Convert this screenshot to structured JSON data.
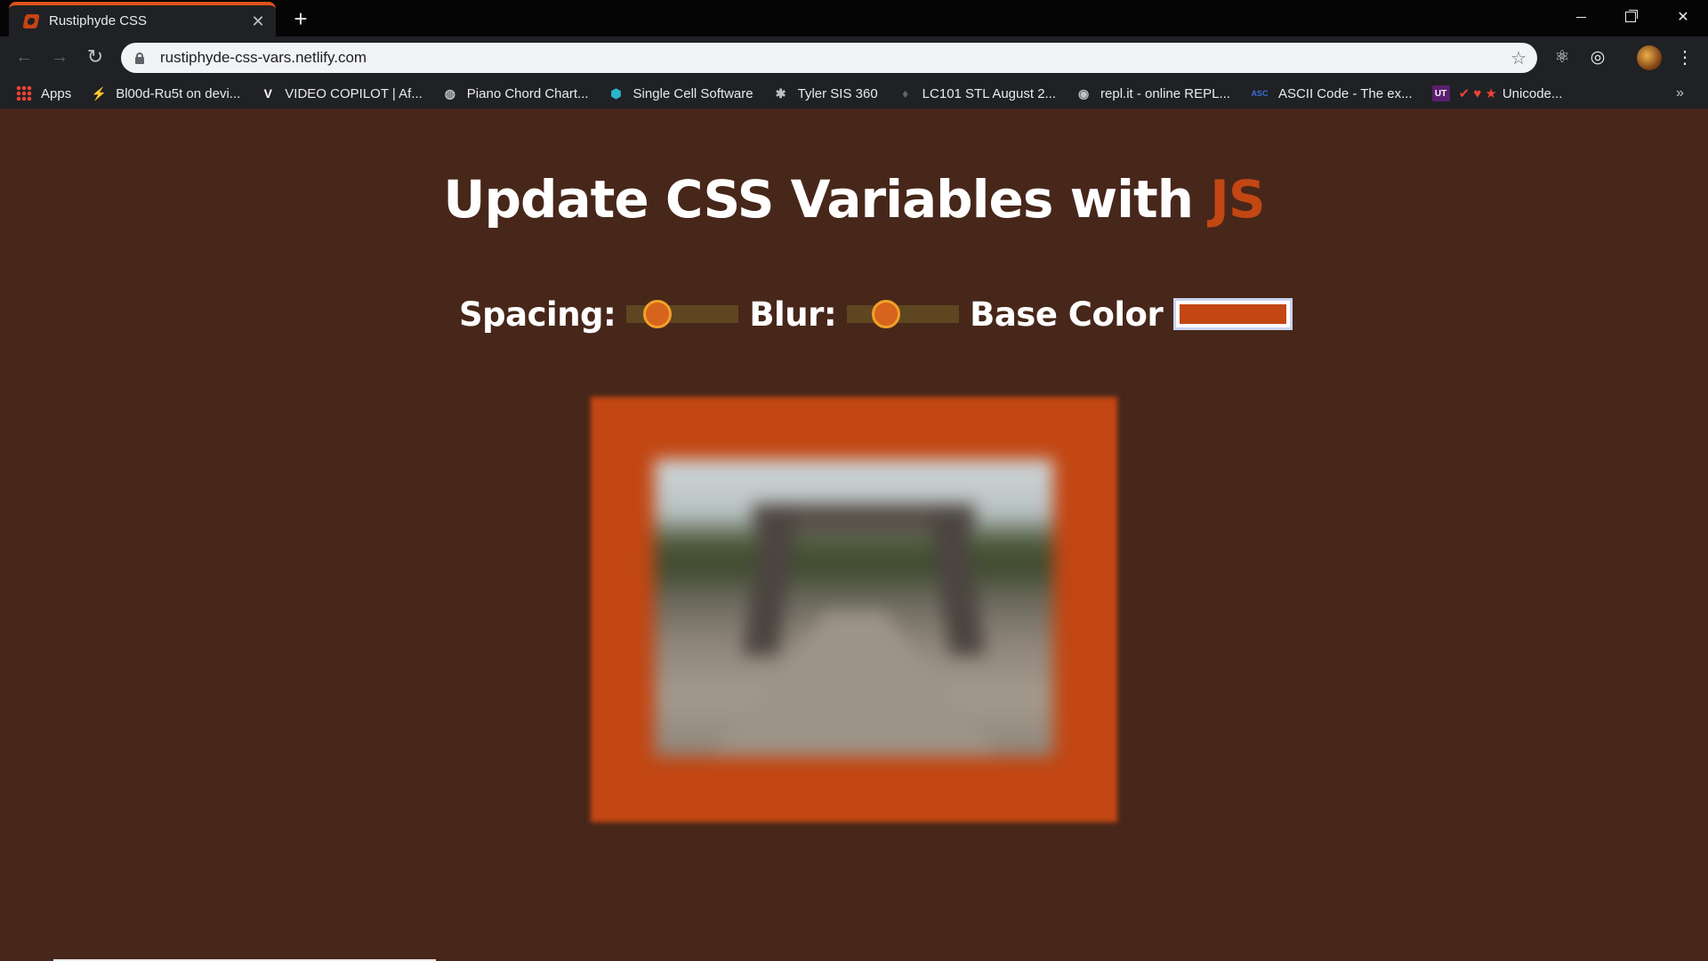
{
  "browser": {
    "tab_title": "Rustiphyde CSS",
    "tab_close_glyph": "✕",
    "new_tab_glyph": "+",
    "url": "rustiphyde-css-vars.netlify.com",
    "back_glyph": "←",
    "forward_glyph": "→",
    "reload_glyph": "↻",
    "star_glyph": "☆",
    "close_glyph": "✕",
    "react_glyph": "⚛",
    "target_glyph": "◎",
    "menu_glyph": "⋮"
  },
  "bookmarks": [
    {
      "label": "Apps",
      "icon": "apps-grid-icon",
      "glyph": "",
      "color": "#ea4335"
    },
    {
      "label": "Bl00d-Ru5t on devi...",
      "icon": "lightning-icon",
      "glyph": "⚡",
      "color": "#2ecc40"
    },
    {
      "label": "VIDEO COPILOT | Af...",
      "icon": "v-icon",
      "glyph": "V",
      "color": "#ffffff"
    },
    {
      "label": "Piano Chord Chart...",
      "icon": "globe-icon",
      "glyph": "◍",
      "color": "#bdc1c6"
    },
    {
      "label": "Single Cell Software",
      "icon": "cube-icon",
      "glyph": "⬢",
      "color": "#2ab6c9"
    },
    {
      "label": "Tyler SIS 360",
      "icon": "satellite-icon",
      "glyph": "✱",
      "color": "#bdc1c6"
    },
    {
      "label": "LC101 STL August 2...",
      "icon": "microphone-icon",
      "glyph": "♦",
      "color": "#5f6368"
    },
    {
      "label": "repl.it - online REPL...",
      "icon": "repl-icon",
      "glyph": "◉",
      "color": "#bdc1c6"
    },
    {
      "label": "ASCII Code - The ex...",
      "icon": "asc-icon",
      "glyph": "ASC",
      "color": "#3b6fd8"
    },
    {
      "label": "Unicode...",
      "icon": "ut-icon",
      "glyph": "UT",
      "color": "#ffffff",
      "extra": "✔ ♥ ★"
    }
  ],
  "bookmarks_overflow": "»",
  "page": {
    "heading_main": "Update CSS Variables with ",
    "heading_highlight": "JS",
    "spacing_label": "Spacing:",
    "blur_label": "Blur:",
    "base_color_label": "Base Color",
    "spacing_value": 0.2,
    "blur_value": 0.3,
    "base_color": "#c24713"
  },
  "colors": {
    "page_bg": "#47271a",
    "accent": "#c24713",
    "slider_track": "#5e4620",
    "slider_thumb": "#d6641d"
  }
}
